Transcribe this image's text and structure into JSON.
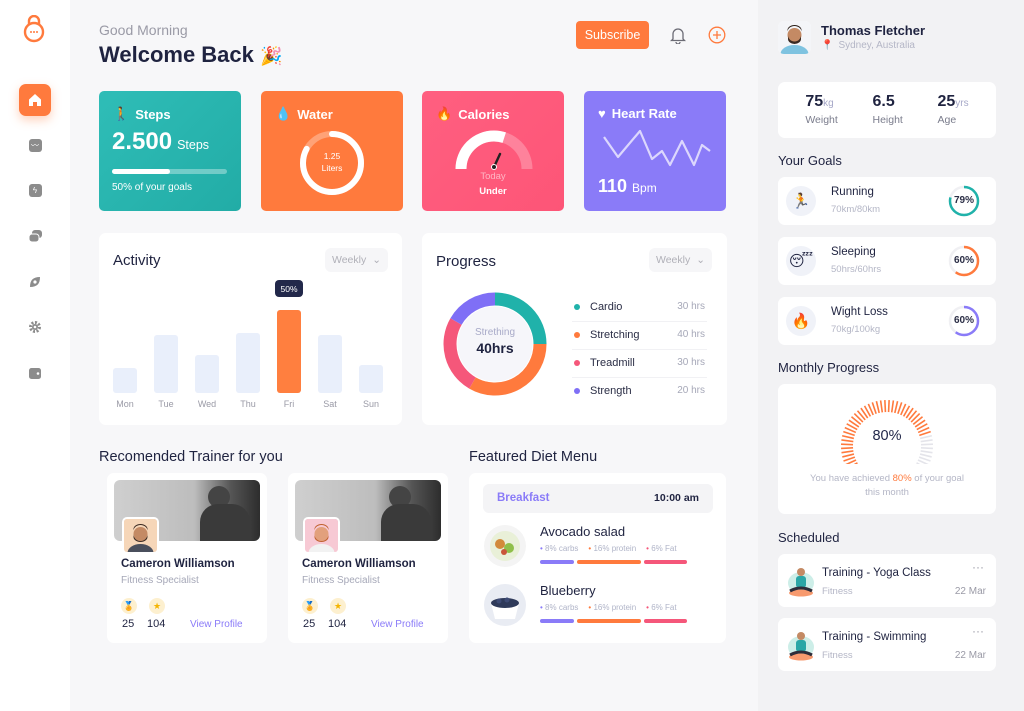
{
  "sidebar": {
    "logo": "kettlebell-logo",
    "items": [
      {
        "name": "home",
        "active": true
      },
      {
        "name": "analytics",
        "active": false
      },
      {
        "name": "activity",
        "active": false
      },
      {
        "name": "messages",
        "active": false
      },
      {
        "name": "explore",
        "active": false
      },
      {
        "name": "settings",
        "active": false
      },
      {
        "name": "wallet",
        "active": false
      }
    ]
  },
  "header": {
    "greeting": "Good Morning",
    "title": "Welcome Back",
    "title_emoji": "🎉",
    "subscribe_label": "Subscribe"
  },
  "stats": {
    "steps": {
      "title": "Steps",
      "value": "2.500",
      "unit": "Steps",
      "progress": 0.5,
      "caption": "50% of your goals",
      "color": "#2cb8b3"
    },
    "water": {
      "title": "Water",
      "value": "1.25",
      "unit": "Liters",
      "progress": 0.83,
      "color": "#ff7a3d"
    },
    "calories": {
      "title": "Calories",
      "label1": "Today",
      "label2": "Under",
      "progress": 0.6,
      "color": "#ff5c7c"
    },
    "heart": {
      "title": "Heart Rate",
      "value": "110",
      "unit": "Bpm",
      "color": "#8a7bf8"
    }
  },
  "activity": {
    "title": "Activity",
    "filter": "Weekly",
    "tooltip": "50%",
    "highlight_index": 4,
    "days": [
      "Mon",
      "Tue",
      "Wed",
      "Thu",
      "Fri",
      "Sat",
      "Sun"
    ],
    "values": [
      15,
      35,
      23,
      36,
      50,
      35,
      17
    ]
  },
  "progress": {
    "title": "Progress",
    "filter": "Weekly",
    "center_label": "Strething",
    "center_value": "40hrs",
    "items": [
      {
        "label": "Cardio",
        "value": "30 hrs",
        "hours": 30,
        "color": "#20b2aa"
      },
      {
        "label": "Stretching",
        "value": "40 hrs",
        "hours": 40,
        "color": "#ff7a3d"
      },
      {
        "label": "Treadmill",
        "value": "30 hrs",
        "hours": 30,
        "color": "#f5577a"
      },
      {
        "label": "Strength",
        "value": "20 hrs",
        "hours": 20,
        "color": "#7f6ff6"
      }
    ]
  },
  "trainers": {
    "title": "Recomended Trainer for you",
    "list": [
      {
        "name": "Cameron Williamson",
        "role": "Fitness Specialist",
        "awards": "25",
        "stars": "104",
        "link": "View Profile"
      },
      {
        "name": "Cameron Williamson",
        "role": "Fitness Specialist",
        "awards": "25",
        "stars": "104",
        "link": "View Profile"
      }
    ]
  },
  "diet": {
    "title": "Featured Diet Menu",
    "meal": "Breakfast",
    "time": "10:00 am",
    "items": [
      {
        "name": "Avocado salad",
        "carbs": "8% carbs",
        "protein": "16% protein",
        "fat": "6% Fat"
      },
      {
        "name": "Blueberry",
        "carbs": "8% carbs",
        "protein": "16% protein",
        "fat": "6% Fat"
      }
    ]
  },
  "profile": {
    "name": "Thomas Fletcher",
    "location": "Sydney, Australia",
    "stats": [
      {
        "value": "75",
        "unit": "kg",
        "label": "Weight"
      },
      {
        "value": "6.5",
        "unit": "",
        "label": "Height"
      },
      {
        "value": "25",
        "unit": "yrs",
        "label": "Age"
      }
    ]
  },
  "goals": {
    "title": "Your Goals",
    "items": [
      {
        "name": "Running",
        "detail": "70km/80km",
        "percent": "79%",
        "progress": 0.79,
        "color": "#20b2aa",
        "emoji": "🏃"
      },
      {
        "name": "Sleeping",
        "detail": "50hrs/60hrs",
        "percent": "60%",
        "progress": 0.6,
        "color": "#ff7a3d",
        "emoji": "😴"
      },
      {
        "name": "Wight Loss",
        "detail": "70kg/100kg",
        "percent": "60%",
        "progress": 0.6,
        "color": "#8a7bf8",
        "emoji": "🔥"
      }
    ]
  },
  "monthly": {
    "title": "Monthly Progress",
    "value": "80%",
    "progress": 0.8,
    "text_before": "You have achieved ",
    "text_highlight": "80%",
    "text_after": " of your goal this month"
  },
  "scheduled": {
    "title": "Scheduled",
    "items": [
      {
        "title": "Training - Yoga Class",
        "category": "Fitness",
        "date": "22 Mar"
      },
      {
        "title": "Training - Swimming",
        "category": "Fitness",
        "date": "22 Mar"
      }
    ]
  }
}
